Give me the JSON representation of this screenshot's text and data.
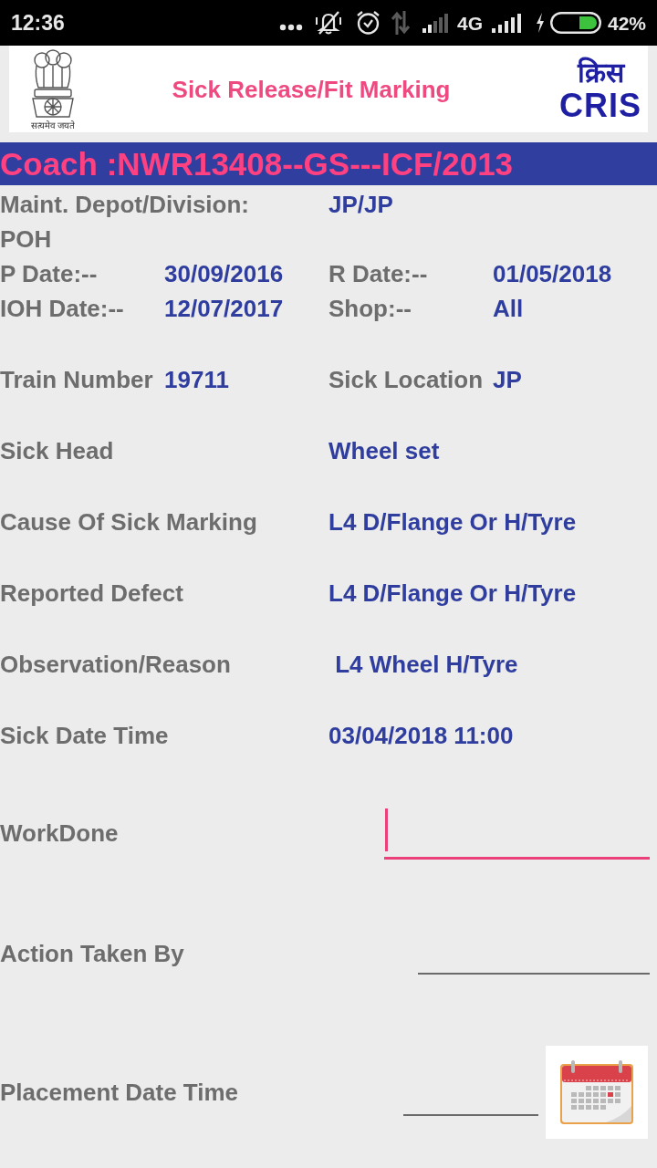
{
  "status_bar": {
    "time": "12:36",
    "network": "4G",
    "battery": "42%"
  },
  "header": {
    "emblem_motto": "सत्यमेव जयते",
    "title": "Sick Release/Fit Marking",
    "logo_hindi": "क्रिस",
    "logo_text": "CRIS"
  },
  "coach_bar": {
    "text": "Coach :NWR13408--GS---ICF/2013"
  },
  "summary_rows": [
    {
      "kind": "wide",
      "label": "Maint. Depot/Division:",
      "value": "JP/JP"
    },
    {
      "kind": "wide",
      "label": "POH"
    },
    {
      "kind": "split",
      "pairs": [
        {
          "label": "P Date:--",
          "value": "30/09/2016"
        },
        {
          "label": "R Date:--",
          "value": "01/05/2018"
        }
      ]
    },
    {
      "kind": "split",
      "pairs": [
        {
          "label": "IOH Date:--",
          "value": "12/07/2017"
        },
        {
          "label": "Shop:--",
          "value": "All"
        }
      ]
    }
  ],
  "detail_rows": [
    {
      "kind": "split",
      "pairs": [
        {
          "label": "Train Number",
          "value": "19711"
        },
        {
          "label": "Sick Location",
          "value": "JP"
        }
      ]
    },
    {
      "kind": "wide",
      "label": "Sick Head",
      "value": "Wheel set"
    },
    {
      "kind": "wide",
      "label": "Cause Of Sick Marking",
      "value": "L4 D/Flange Or H/Tyre"
    },
    {
      "kind": "wide",
      "label": "Reported Defect",
      "value": "L4 D/Flange Or H/Tyre"
    },
    {
      "kind": "wide",
      "label": "Observation/Reason",
      "value": " L4 Wheel H/Tyre"
    },
    {
      "kind": "wide",
      "label": "Sick Date Time",
      "value": "03/04/2018 11:00"
    }
  ],
  "form_fields": [
    {
      "kind": "text",
      "label": "WorkDone",
      "focused": true
    },
    {
      "kind": "text",
      "label": "Action Taken By",
      "focused": false
    },
    {
      "kind": "date",
      "label": "Placement Date Time",
      "focused": false
    }
  ]
}
